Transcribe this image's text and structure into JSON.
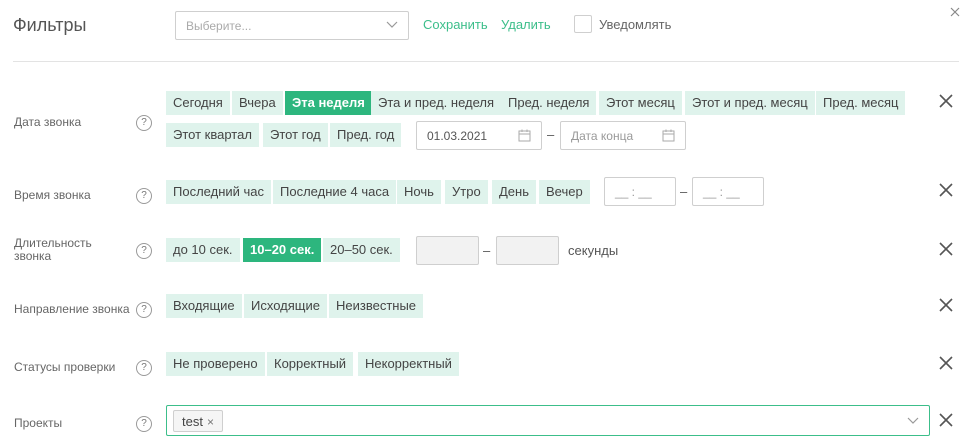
{
  "header": {
    "title": "Фильтры",
    "select_placeholder": "Выберите...",
    "save_label": "Сохранить",
    "delete_label": "Удалить",
    "notify_label": "Уведомлять",
    "notify_checked": false
  },
  "colors": {
    "accent": "#2db67e",
    "chip_bg": "#dff3ec",
    "link": "#3cbe8a"
  },
  "help_glyph": "?",
  "filters": {
    "call_date": {
      "label": "Дата звонка",
      "presets": [
        "Сегодня",
        "Вчера",
        "Эта неделя",
        "Эта и пред. неделя",
        "Пред. неделя",
        "Этот месяц",
        "Этот и пред. месяц",
        "Пред. месяц",
        "Этот квартал",
        "Этот год",
        "Пред. год"
      ],
      "active": "Эта неделя",
      "start_value": "01.03.2021",
      "end_placeholder": "Дата конца",
      "separator": "–"
    },
    "call_time": {
      "label": "Время звонка",
      "presets": [
        "Последний час",
        "Последние 4 часа",
        "Ночь",
        "Утро",
        "День",
        "Вечер"
      ],
      "from_placeholder": "__ : __",
      "to_placeholder": "__ : __",
      "separator": "–"
    },
    "call_duration": {
      "label_line1": "Длительность",
      "label_line2": "звонка",
      "presets": [
        "до 10 сек.",
        "10–20 сек.",
        "20–50 сек."
      ],
      "active": "10–20 сек.",
      "separator": "–",
      "units": "секунды"
    },
    "call_direction": {
      "label": "Направление звонка",
      "options": [
        "Входящие",
        "Исходящие",
        "Неизвестные"
      ]
    },
    "check_status": {
      "label": "Статусы проверки",
      "options": [
        "Не проверено",
        "Корректный",
        "Некорректный"
      ]
    },
    "projects": {
      "label": "Проекты",
      "tags": [
        "test"
      ],
      "remove_glyph": "×"
    }
  }
}
